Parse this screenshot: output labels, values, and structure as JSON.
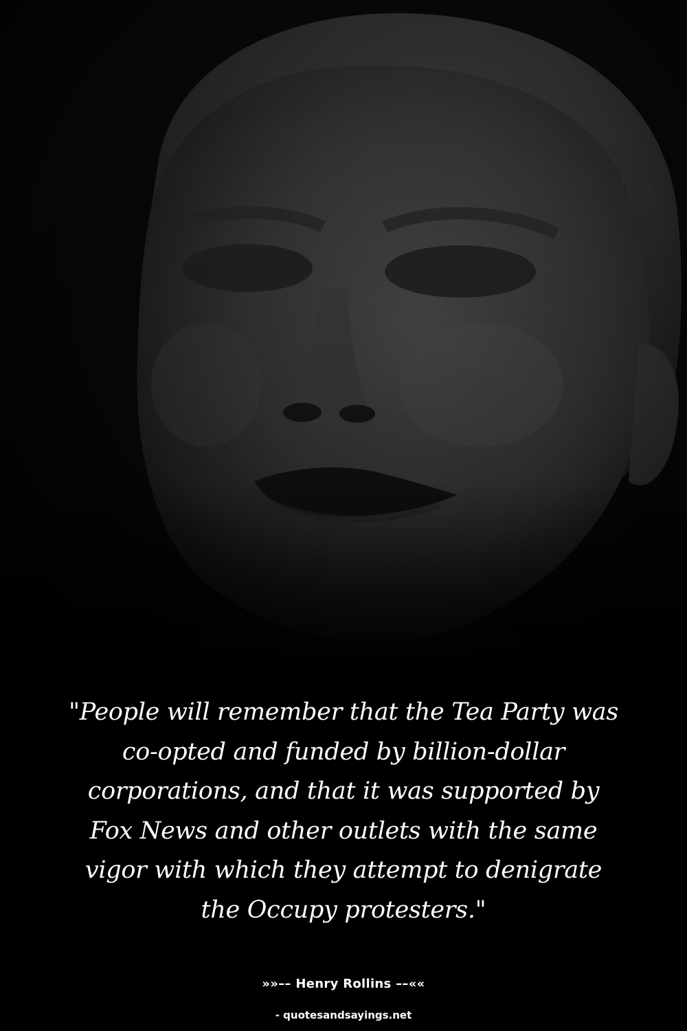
{
  "quote": {
    "lines": [
      "\"People will remember that the Tea Party was",
      "co-opted and funded by billion-dollar",
      "corporations, and that it was supported by",
      "Fox News and other outlets with the same",
      "vigor with which they attempt to denigrate",
      "the Occupy protesters.\""
    ]
  },
  "author": "»»–– Henry Rollins ––««",
  "source": "- quotesandsayings.net",
  "colors": {
    "background": "#000000",
    "text": "#ffffff"
  }
}
